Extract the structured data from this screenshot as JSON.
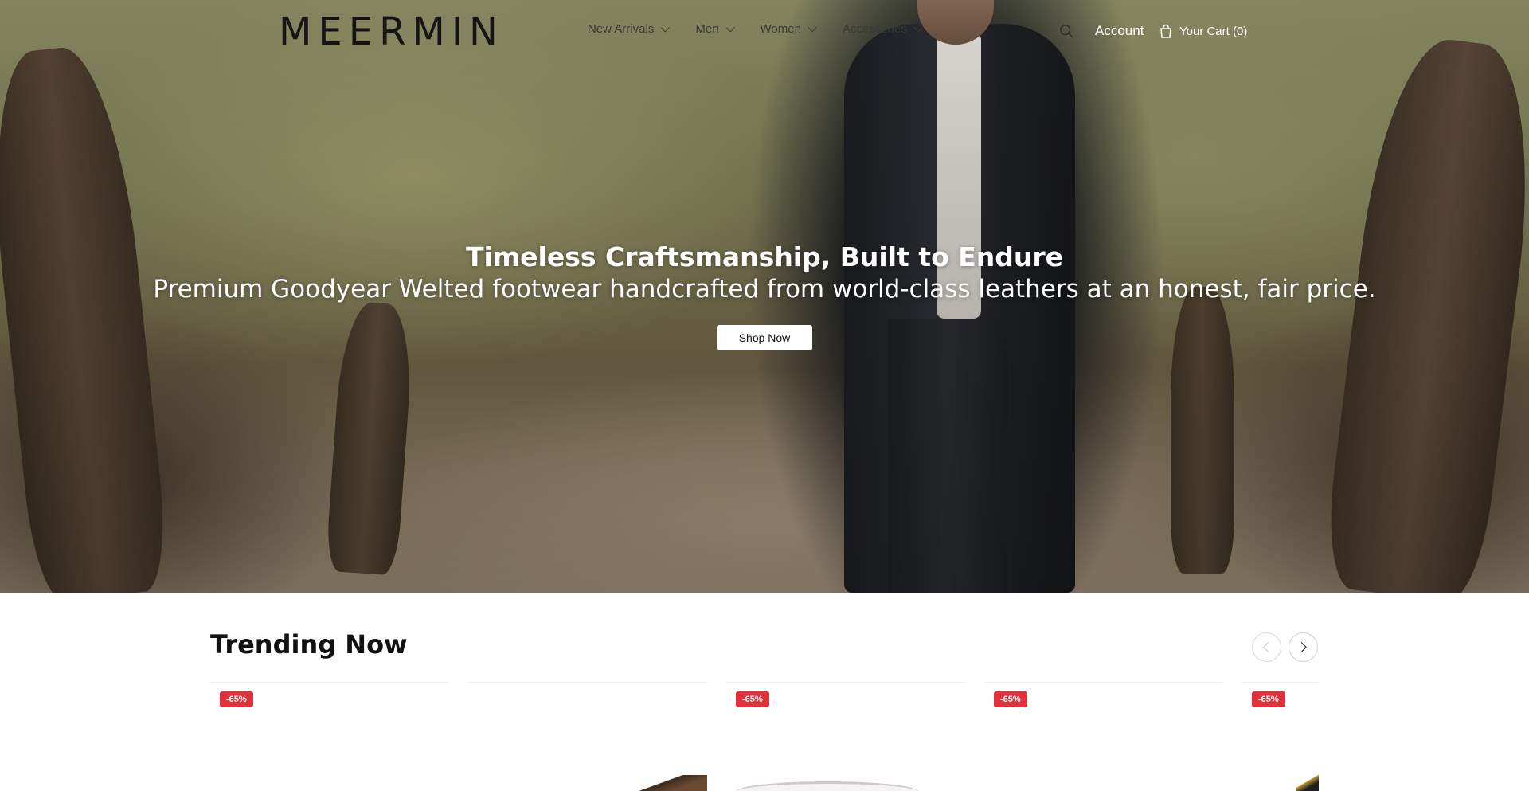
{
  "brand": {
    "logo_text": "MEERMIN"
  },
  "nav": {
    "menu": [
      {
        "label": "New Arrivals"
      },
      {
        "label": "Men"
      },
      {
        "label": "Women"
      },
      {
        "label": "Accessories"
      }
    ],
    "account_label": "Account",
    "cart_label": "Your Cart (0)"
  },
  "hero": {
    "title": "Timeless Craftsmanship, Built to Endure",
    "subtitle": "Premium Goodyear Welted footwear handcrafted from world-class leathers at an honest, fair price.",
    "cta_label": "Shop Now"
  },
  "trending": {
    "title": "Trending Now",
    "products": [
      {
        "badge": "-65%"
      },
      {
        "badge": ""
      },
      {
        "badge": "-65%"
      },
      {
        "badge": "-65%"
      },
      {
        "badge": "-65%"
      }
    ]
  },
  "colors": {
    "sale_badge": "#e0323a",
    "hero_text": "#ffffff"
  },
  "icons": [
    "search-icon",
    "cart-bag-icon",
    "chevron-down-icon",
    "arrow-left-icon",
    "arrow-right-icon"
  ]
}
